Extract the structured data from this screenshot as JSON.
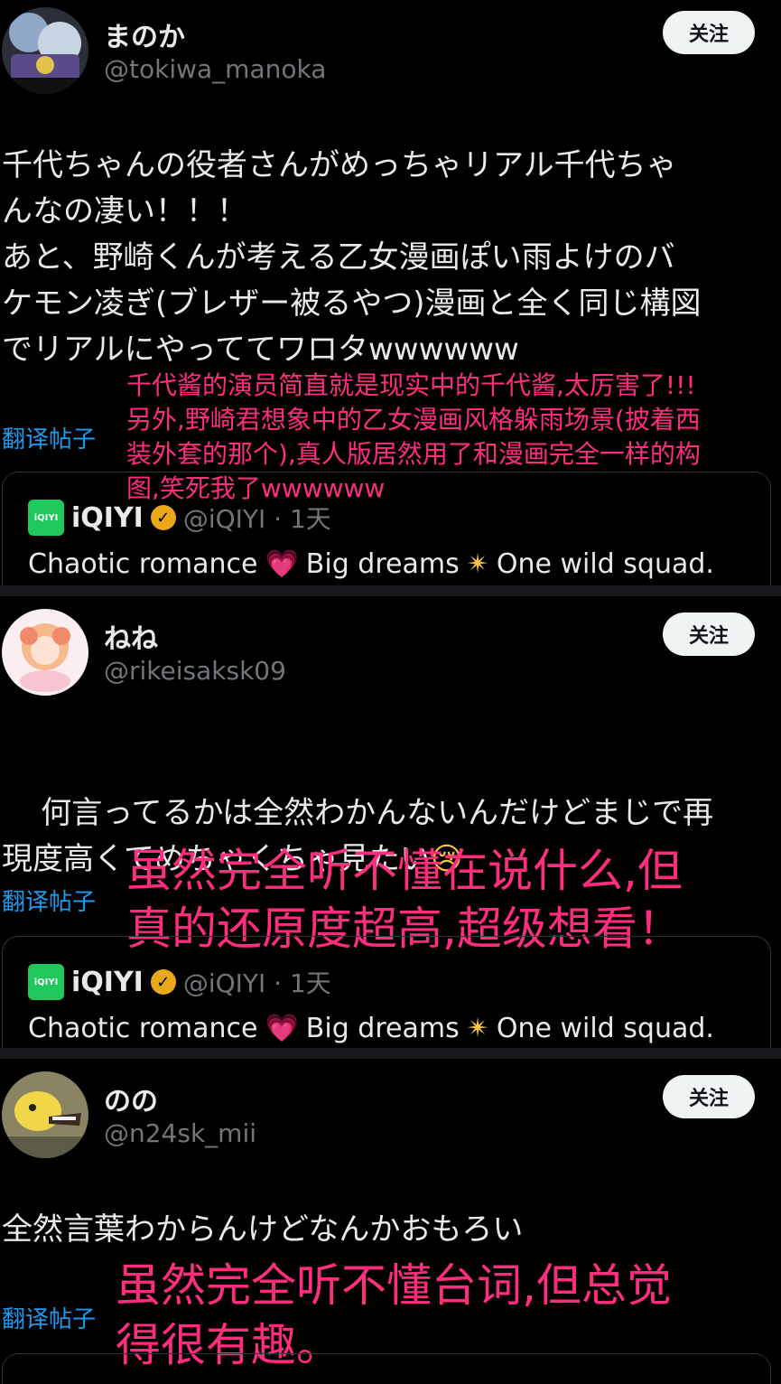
{
  "posts": [
    {
      "name": "まのか",
      "handle": "@tokiwa_manoka",
      "follow_label": "关注",
      "text": "千代ちゃんの役者さんがめっちゃリアル千代ちゃ\nんなの凄い！！！\nあと、野崎くんが考える乙女漫画ぽい雨よけのバ\nケモン凌ぎ(ブレザー被るやつ)漫画と全く同じ構図\nでリアルにやっててワロタwwwwww",
      "translate_label": "翻译帖子",
      "overlay": "千代酱的演员简直就是现实中的千代酱,太厉害了!!!\n另外,野崎君想象中的乙女漫画风格躲雨场景(披着西\n装外套的那个),真人版居然用了和漫画完全一样的构\n图,笑死我了wwwwww",
      "quote": {
        "logo": "iQIYI",
        "name": "iQIYI",
        "handle": "@iQIYI · 1天",
        "text1": "Chaotic romance",
        "text2": "Big dreams",
        "text3": "One wild squad."
      }
    },
    {
      "name": "ねね",
      "handle": "@rikeisaksk09",
      "follow_label": "关注",
      "text": "何言ってるかは全然わかんないんだけどまじで再\n現度高くてめちゃくちゃ見たい",
      "translate_label": "翻译帖子",
      "overlay": "虽然完全听不懂在说什么,但\n真的还原度超高,超级想看！",
      "quote": {
        "logo": "iQIYI",
        "name": "iQIYI",
        "handle": "@iQIYI · 1天",
        "text1": "Chaotic romance",
        "text2": "Big dreams",
        "text3": "One wild squad."
      }
    },
    {
      "name": "のの",
      "handle": "@n24sk_mii",
      "follow_label": "关注",
      "text": "全然言葉わからんけどなんかおもろい",
      "translate_label": "翻译帖子",
      "overlay": "虽然完全听不懂台词,但总觉\n得很有趣。"
    }
  ],
  "colors": {
    "background": "#000000",
    "overlay_text": "#ff2d7d",
    "translate_link": "#1d9bf0",
    "follow_button": "#eff3f4",
    "iqiyi_green": "#1ec85b"
  },
  "icons": [
    "verified-badge-icon",
    "heart-emoji",
    "sparkle-emoji",
    "crying-face-emoji"
  ]
}
